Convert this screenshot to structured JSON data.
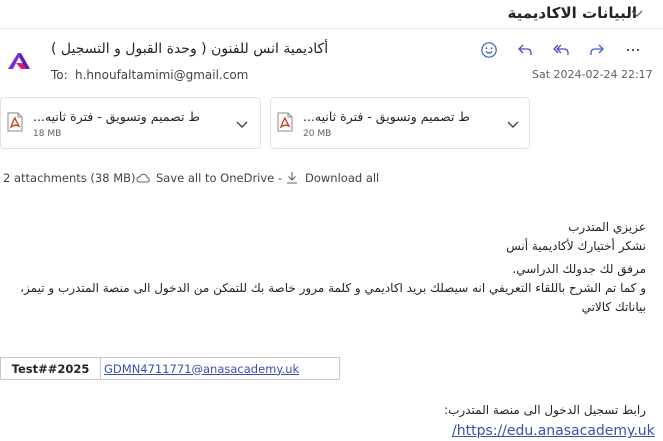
{
  "subject": "البيانات الاكاديمية",
  "sender": {
    "name": "أكاديمية انس للفنون ( وحدة القبول و التسجيل )"
  },
  "recipient": {
    "label": "To:",
    "address": "h.hnoufaltamimi@gmail.com"
  },
  "date": "Sat 2024-02-24 22:17",
  "toolbar": {
    "icons": [
      "smile-icon",
      "reply-icon",
      "reply-all-icon",
      "forward-icon",
      "more-icon"
    ]
  },
  "attachments": [
    {
      "name": "ط تصميم وتسويق - فترة ثانيه...",
      "size": "18 MB",
      "icon": "pdf-icon"
    },
    {
      "name": "ط تصميم وتسويق - فترة ثانيه...",
      "size": "20 MB",
      "icon": "pdf-icon"
    }
  ],
  "attachment_bar": {
    "count": "2 attachments (38 MB)",
    "save_onedrive": "Save all to OneDrive -",
    "download_all": "Download all"
  },
  "body": {
    "lines": [
      "عزيزي المتدرب",
      "نشكر أختيارك لأكاديمية أنس",
      "مرفق لك جدولك الدراسي.",
      "و كما تم الشرح باللقاء التعريفي انه سيصلك بريد اكاديمي و كلمة مرور خاصة بك للتمكن من الدخول الى منصة المتدرب و تيمز،",
      "بياناتك كالاتي"
    ],
    "credentials": {
      "password": "Test##2025",
      "email": "GDMN4711771@anasacademy.uk"
    },
    "register_label": "رابط تسجيل الدخول الى منصة المتدرب:",
    "register_url": "/https://edu.anasacademy.uk"
  }
}
